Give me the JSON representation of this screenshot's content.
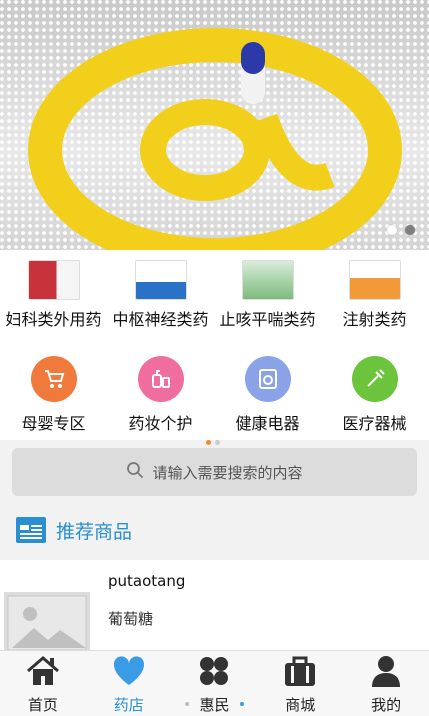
{
  "banner": {
    "page_count": 2,
    "active_page": 2
  },
  "categories_row1": [
    {
      "label": "妇科类外用药"
    },
    {
      "label": "中枢神经类药"
    },
    {
      "label": "止咳平喘类药"
    },
    {
      "label": "注射类药"
    }
  ],
  "categories_row2": [
    {
      "label": "母婴专区",
      "color": "#f07a3c",
      "icon": "stroller-icon"
    },
    {
      "label": "药妆个护",
      "color": "#f06e9e",
      "icon": "cosmetics-bottle-icon"
    },
    {
      "label": "健康电器",
      "color": "#8aa3e8",
      "icon": "washing-machine-icon"
    },
    {
      "label": "医疗器械",
      "color": "#6cc43c",
      "icon": "syringe-icon"
    }
  ],
  "search": {
    "placeholder": "请输入需要搜索的内容"
  },
  "recommend": {
    "title": "推荐商品"
  },
  "product": {
    "name": "putaotang",
    "desc": "葡萄糖"
  },
  "tabs": [
    {
      "label": "首页",
      "icon": "home-icon"
    },
    {
      "label": "药店",
      "icon": "heart-icon",
      "active": true
    },
    {
      "label": "惠民",
      "icon": "clover-icon"
    },
    {
      "label": "商城",
      "icon": "briefcase-icon"
    },
    {
      "label": "我的",
      "icon": "user-icon"
    }
  ],
  "colors": {
    "accent": "#2a8fd1",
    "pager_active": "#f08a2c"
  }
}
